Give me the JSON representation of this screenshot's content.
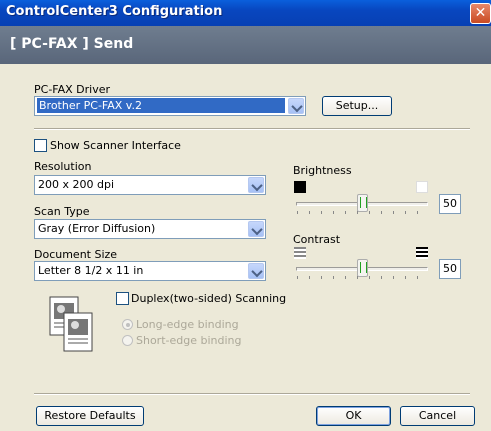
{
  "window": {
    "title": "ControlCenter3 Configuration",
    "close_glyph": "✕"
  },
  "banner": {
    "text": "[ PC-FAX ]  Send"
  },
  "driver": {
    "label": "PC-FAX Driver",
    "selected": "Brother PC-FAX v.2",
    "setup_label": "Setup..."
  },
  "scanner_interface": {
    "label": "Show Scanner Interface",
    "checked": false
  },
  "resolution": {
    "label": "Resolution",
    "selected": "200 x 200 dpi"
  },
  "scan_type": {
    "label": "Scan Type",
    "selected": "Gray (Error Diffusion)"
  },
  "document_size": {
    "label": "Document Size",
    "selected": "Letter 8 1/2 x 11 in"
  },
  "brightness": {
    "label": "Brightness",
    "value": "50",
    "level": 50
  },
  "contrast": {
    "label": "Contrast",
    "value": "50",
    "level": 50
  },
  "duplex": {
    "label": "Duplex(two-sided) Scanning",
    "checked": false,
    "long_edge": "Long-edge binding",
    "short_edge": "Short-edge binding",
    "icon": "duplex-pages-icon"
  },
  "buttons": {
    "restore": "Restore Defaults",
    "ok": "OK",
    "cancel": "Cancel"
  }
}
